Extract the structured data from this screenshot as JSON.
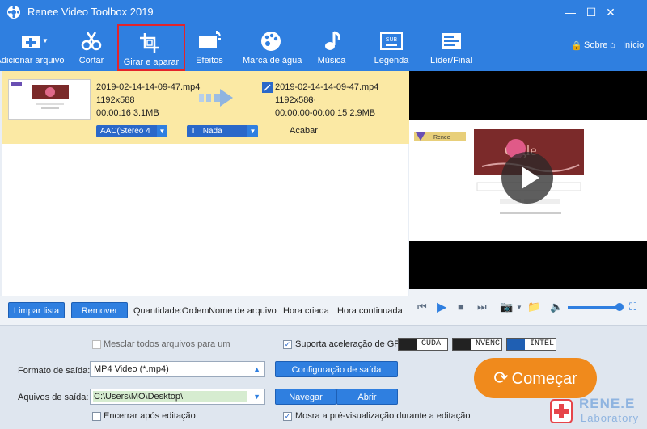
{
  "window": {
    "title": "Renee Video Toolbox 2019",
    "minimize": "—",
    "close": "✕"
  },
  "toolbar": {
    "items": [
      {
        "label": "Adicionar arquivo"
      },
      {
        "label": "Cortar"
      },
      {
        "label": "Girar e aparar"
      },
      {
        "label": "Efeitos"
      },
      {
        "label": "Marca de água"
      },
      {
        "label": "Música"
      },
      {
        "label": "Legenda"
      },
      {
        "label": "Líder/Final"
      }
    ],
    "about": "Sobre",
    "home": "Início"
  },
  "file": {
    "src_name": "2019-02-14-14-09-47.mp4",
    "src_res": "1192x588",
    "src_meta": "00:00:16  3.1MB",
    "dst_name": "2019-02-14-14-09-47.mp4",
    "dst_res": "1192x588",
    "dst_dots": "···",
    "dst_meta": "00:00:00-00:00:15  2.9MB",
    "audio": "AAC(Stereo 4",
    "subtitle_icon": "T",
    "subtitle": "Nada",
    "status": "Acabar"
  },
  "list_actions": {
    "clear": "Limpar lista",
    "remove": "Remover",
    "order_label": "Quantidade:Ordem:",
    "order_name": "Nome de arquivo",
    "order_created": "Hora criada",
    "order_continuous": "Hora continuada"
  },
  "bottom": {
    "merge": "Mesclar todos arquivos para um",
    "gpu": "Suporta aceleração de GPU",
    "gpu_badges": [
      "CUDA",
      "NVENC",
      "INTEL"
    ],
    "format_label": "Formato de saída:",
    "format_value": "MP4 Video (*.mp4)",
    "config_button": "Configuração de saída",
    "output_label": "Aquivos de saída:",
    "output_value": "C:\\Users\\MO\\Desktop\\",
    "browse": "Navegar",
    "open": "Abrir",
    "shutdown": "Encerrar após editação",
    "preview_during": "Mosra a pré-visualização durante a editação",
    "start": "Começar"
  },
  "brand": {
    "name": "RENE.E",
    "sub": "Laboratory"
  },
  "colors": {
    "accent": "#2f7fe0",
    "start": "#f08a1c",
    "highlight": "#e3242b",
    "row": "#fbe9a4"
  }
}
